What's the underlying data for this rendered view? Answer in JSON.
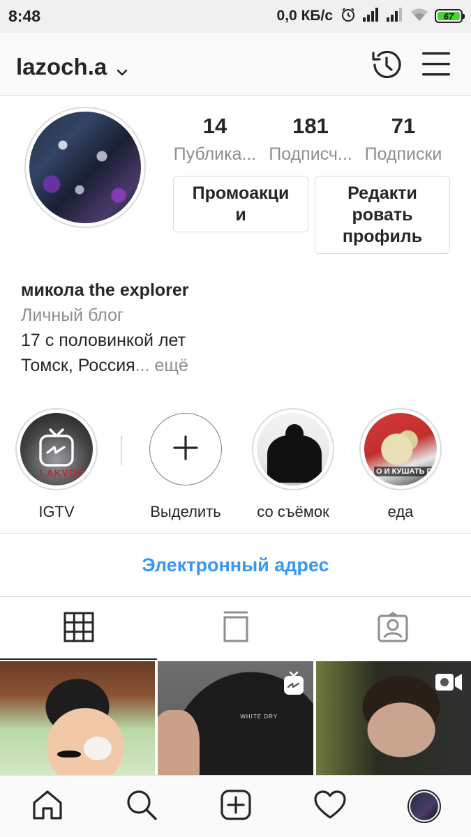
{
  "status_bar": {
    "time": "8:48",
    "speed": "0,0 КБ/с",
    "battery": "67",
    "icons": [
      "alarm-icon",
      "signal-icon",
      "signal-icon",
      "wifi-icon",
      "battery-icon"
    ]
  },
  "header": {
    "username": "lazoch.a",
    "icons": [
      "chevron-down-icon",
      "history-icon",
      "menu-icon"
    ]
  },
  "profile": {
    "stats": [
      {
        "value": "14",
        "label": "Публика..."
      },
      {
        "value": "181",
        "label": "Подписч..."
      },
      {
        "value": "71",
        "label": "Подписки"
      }
    ],
    "promo_button": "Промоакци и",
    "edit_button": "Редакти ровать профиль"
  },
  "bio": {
    "name": "микола the explorer",
    "category": "Личный блог",
    "line1": "17 с половинкой лет",
    "line2": "Томск, Россия",
    "more": "... ещё"
  },
  "highlights": [
    {
      "label": "IGTV",
      "cover_text": "LAKVDS"
    },
    {
      "label": "Выделить"
    },
    {
      "label": "со съёмок"
    },
    {
      "label": "еда",
      "cover_text": "О И КУШАТЬ ГОТОВИ"
    }
  ],
  "email_link": "Электронный адрес",
  "tabs": [
    {
      "icon": "grid-icon",
      "active": true
    },
    {
      "icon": "igtv-feed-icon",
      "active": false
    },
    {
      "icon": "tagged-icon",
      "active": false
    }
  ],
  "posts": [
    {
      "badge": ""
    },
    {
      "badge": "igtv-icon",
      "caption": "WHITE DRY"
    },
    {
      "badge": "video-icon"
    }
  ],
  "bottom_nav": [
    "home-icon",
    "search-icon",
    "add-post-icon",
    "heart-icon",
    "profile-avatar"
  ],
  "colors": {
    "link": "#3897f0",
    "muted": "#8e8e8e",
    "text": "#262626",
    "border": "#dbdbdb",
    "battery": "#4cd137"
  }
}
